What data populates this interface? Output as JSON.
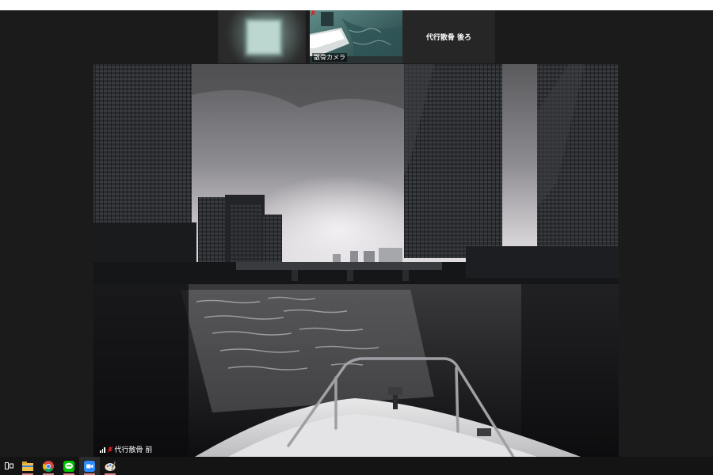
{
  "thumbnails": [
    {
      "name": "",
      "blurred": true
    },
    {
      "name": "散骨カメラ",
      "muted": true
    },
    {
      "name": "代行散骨 後ろ"
    }
  ],
  "main_video": {
    "speaker_name": "代行散骨 前",
    "muted": true
  },
  "taskbar": {
    "icons": [
      "task-view-icon",
      "file-explorer-icon",
      "chrome-icon",
      "line-icon",
      "zoom-icon",
      "paint-icon"
    ],
    "accent": "#d98a8a"
  },
  "colors": {
    "background": "#1b1b1b",
    "taskbar": "#141414",
    "mic_muted": "#e02020"
  }
}
